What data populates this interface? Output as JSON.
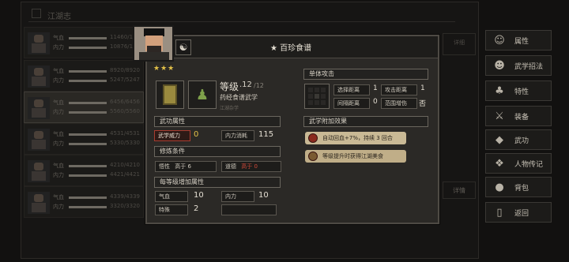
{
  "background": {
    "title": "江湖志",
    "rows": [
      {
        "hp_label": "气血",
        "mp_label": "内力",
        "hp": "11460/11460",
        "mp": "10876/10876"
      },
      {
        "hp_label": "气血",
        "mp_label": "内力",
        "hp": "8920/8920",
        "mp": "5247/5247"
      },
      {
        "hp_label": "气血",
        "mp_label": "内力",
        "hp": "6456/6456",
        "mp": "5560/5560"
      },
      {
        "hp_label": "气血",
        "mp_label": "内力",
        "hp": "4531/4531",
        "mp": "5330/5330"
      },
      {
        "hp_label": "气血",
        "mp_label": "内力",
        "hp": "4210/4210",
        "mp": "4421/4421"
      },
      {
        "hp_label": "气血",
        "mp_label": "内力",
        "hp": "4339/4339",
        "mp": "3320/3320"
      }
    ],
    "detail_top": "详细",
    "detail_bottom": "详情"
  },
  "menu": [
    {
      "label": "属性",
      "icon": "person-icon"
    },
    {
      "label": "武学招法",
      "icon": "martial-icon"
    },
    {
      "label": "特性",
      "icon": "trait-icon"
    },
    {
      "label": "装备",
      "icon": "sword-icon"
    },
    {
      "label": "武功",
      "icon": "scroll-icon"
    },
    {
      "label": "人物传记",
      "icon": "book-icon"
    },
    {
      "label": "背包",
      "icon": "bag-icon"
    },
    {
      "label": "返回",
      "icon": "return-icon"
    }
  ],
  "skill": {
    "title": "★ 百珍食谱",
    "stars": "★★★",
    "level_label": "等级",
    "level": ".12",
    "level_max": "/12",
    "type": "药经食谱武学",
    "subtype": "江湖杂学"
  },
  "sections": {
    "martial_attr": "武功属性",
    "requirements": "修炼条件",
    "per_level": "每等级增加属性",
    "single_attack": "单体攻击",
    "extra_effect": "武学附加效果"
  },
  "martial_attr": {
    "power_label": "武学威力",
    "power_value": "0",
    "cost_label": "内力消耗",
    "cost_value": "115"
  },
  "requirements": {
    "insight_label": "悟性",
    "insight_req": "高于 6",
    "morality_label": "道德",
    "morality_req": "高于 0"
  },
  "per_level": {
    "hp_label": "气血",
    "hp_value": "10",
    "mp_label": "内力",
    "mp_value": "10",
    "special_label": "特殊",
    "special_value": "2"
  },
  "attack": {
    "select_range_label": "选择距离",
    "select_range_value": "1",
    "attack_range_label": "攻击距离",
    "attack_range_value": "1",
    "interval_label": "间隔距离",
    "interval_value": "0",
    "scope_label": "范围增伤",
    "scope_value": "否"
  },
  "effects": [
    "自动回血+7%，持续 3 回合",
    "等级提升时获得江湖美食"
  ]
}
